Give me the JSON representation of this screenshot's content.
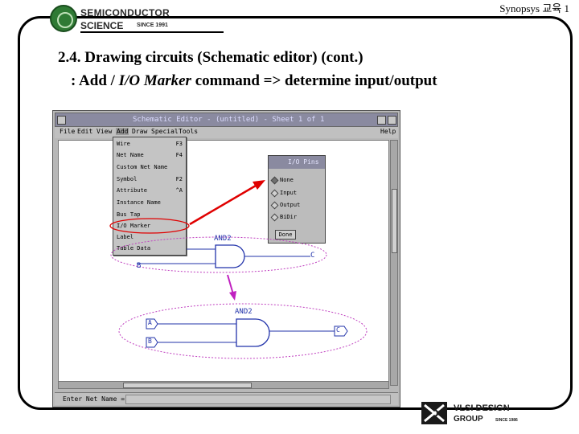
{
  "header": {
    "logo_line1": "SEMICONDUCTOR",
    "logo_line2": "SCIENCE",
    "logo_since": "SINCE 1991",
    "top_right": "Synopsys 교육 1"
  },
  "title": {
    "line1": "2.4. Drawing circuits (Schematic editor)   (cont.)",
    "line2_prefix": ":  Add / ",
    "line2_italic": "I/O Marker",
    "line2_suffix": " command => determine input/output"
  },
  "window": {
    "title": "Schematic Editor - (untitled) - Sheet 1 of 1",
    "menus": [
      "File",
      "Edit",
      "View",
      "Add",
      "Draw",
      "Special",
      "Tools"
    ],
    "help": "Help",
    "command_label": "Enter Net Name ="
  },
  "add_menu": {
    "items": [
      {
        "label": "Wire",
        "key": "F3"
      },
      {
        "label": "Net Name",
        "key": "F4"
      },
      {
        "label": "Custom Net Name",
        "key": ""
      },
      {
        "label": "Symbol",
        "key": "F2"
      },
      {
        "label": "Attribute",
        "key": "^A"
      },
      {
        "label": "Instance Name",
        "key": ""
      },
      {
        "label": "Bus Tap",
        "key": ""
      },
      {
        "label": "I/O Marker",
        "key": ""
      },
      {
        "label": "Label",
        "key": ""
      },
      {
        "label": "Table Data",
        "key": ""
      }
    ]
  },
  "io_dialog": {
    "title": "I/O Pins",
    "options": [
      "None",
      "Input",
      "Output",
      "BiDir"
    ],
    "button": "Done"
  },
  "schematic": {
    "gate_top": "AND2",
    "gate_bottom": "AND2",
    "net_b": "B",
    "net_c": "C",
    "pin_a": "A",
    "pin_b": "B",
    "pin_c": "C"
  },
  "footer": {
    "vlsi_line1": "VLSI  DESIGN",
    "vlsi_line2": "GROUP",
    "vlsi_since": "SINCE 1986"
  },
  "colors": {
    "highlight": "#e00000",
    "arrow_red": "#e00000",
    "arrow_magenta": "#c020c0",
    "ellipse": "#c040c0",
    "wire": "#2233aa"
  }
}
